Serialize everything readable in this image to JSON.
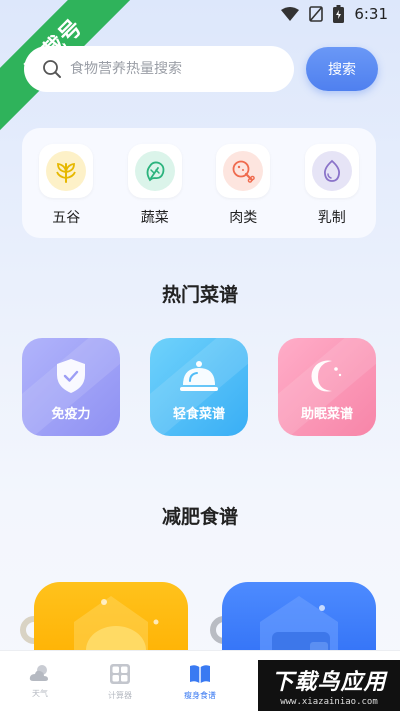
{
  "status_bar": {
    "time": "6:31",
    "icons": [
      "wifi-icon",
      "no-sim-icon",
      "battery-icon"
    ]
  },
  "watermark": {
    "ribbon_text": "下载号"
  },
  "search": {
    "placeholder": "食物营养热量搜索",
    "button_label": "搜索"
  },
  "categories": [
    {
      "label": "五谷",
      "icon": "grain-icon",
      "bg": "#fdf1c8",
      "color": "#e6b800"
    },
    {
      "label": "蔬菜",
      "icon": "vegetable-icon",
      "bg": "#dbf4ea",
      "color": "#2bb37d"
    },
    {
      "label": "肉类",
      "icon": "meat-icon",
      "bg": "#fde5df",
      "color": "#ef6b4e"
    },
    {
      "label": "乳制",
      "icon": "egg-icon",
      "bg": "#e6e4f6",
      "color": "#8a73c9"
    }
  ],
  "hot_recipes": {
    "title": "热门菜谱",
    "items": [
      {
        "label": "免疫力",
        "icon": "shield-icon"
      },
      {
        "label": "轻食菜谱",
        "icon": "food-cloche-icon"
      },
      {
        "label": "助眠菜谱",
        "icon": "moon-icon"
      }
    ]
  },
  "diet_recipes": {
    "title": "减肥食谱"
  },
  "bottom_nav": [
    {
      "label": "天气",
      "icon": "weather-icon",
      "active": false
    },
    {
      "label": "计算器",
      "icon": "calculator-icon",
      "active": false
    },
    {
      "label": "瘦身食谱",
      "icon": "book-icon",
      "active": true
    }
  ],
  "brand_badge": {
    "title": "下载鸟应用",
    "url": "www.xiazainiao.com"
  },
  "colors": {
    "accent": "#3a7af2",
    "ribbon": "#2fb35b"
  }
}
